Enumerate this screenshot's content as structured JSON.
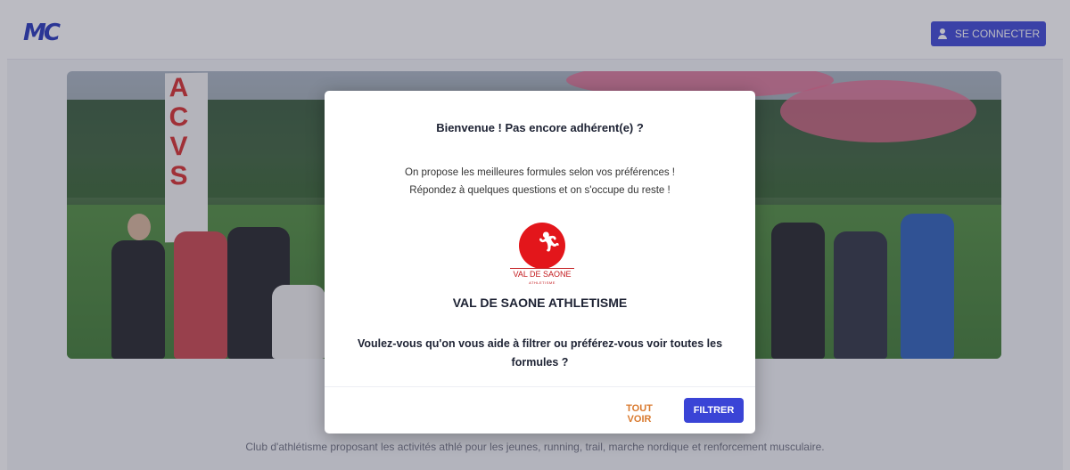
{
  "header": {
    "logo_text": "MC",
    "login_label": "SE CONNECTER",
    "login_icon": "user-icon"
  },
  "hero": {
    "banner_text": "ACVS"
  },
  "modal": {
    "title": "Bienvenue ! Pas encore adhérent(e) ?",
    "subtitle_line1": "On propose les meilleures formules selon vos préférences !",
    "subtitle_line2": "Répondez à quelques questions et on s'occupe du reste !",
    "logo_text": "VAL DE SAONE",
    "logo_subtext": "ATHLETISME",
    "club_name": "VAL DE SAONE ATHLETISME",
    "question": "Voulez-vous qu'on vous aide à filtrer ou préférez-vous voir toutes les formules ?",
    "see_all_label": "TOUT VOIR",
    "filter_label": "FILTRER"
  },
  "footer": {
    "description": "Club d'athlétisme proposant les activités athlé pour les jeunes, running, trail, marche nordique et renforcement musculaire."
  },
  "colors": {
    "primary": "#3a44d6",
    "accent": "#d97a2f",
    "club_red": "#e3161b"
  }
}
